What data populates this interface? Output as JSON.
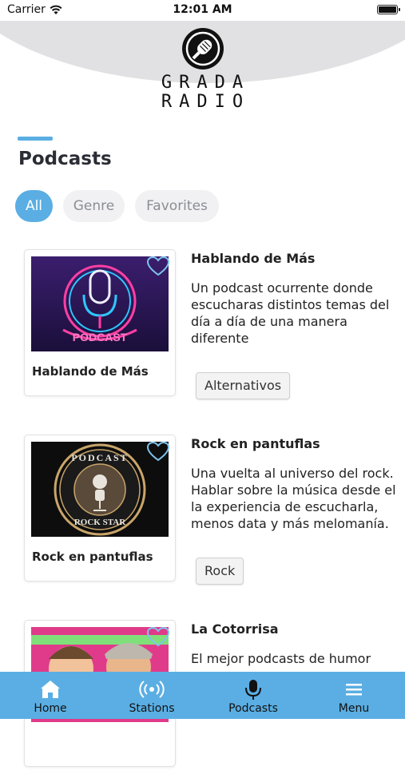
{
  "status_bar": {
    "carrier": "Carrier",
    "time": "12:01 AM"
  },
  "brand": {
    "line1": "GRADA",
    "line2": "RADIO"
  },
  "page": {
    "title": "Podcasts"
  },
  "filters": [
    {
      "label": "All",
      "active": true
    },
    {
      "label": "Genre",
      "active": false
    },
    {
      "label": "Favorites",
      "active": false
    }
  ],
  "podcasts": [
    {
      "card_title": "Hablando de Más",
      "title": "Hablando de Más",
      "description": "Un podcast ocurrente donde escucharas distintos temas del día a día de una manera diferente",
      "genre": "Alternativos",
      "thumb_text": "PODCAST"
    },
    {
      "card_title": "Rock en pantuflas",
      "title": "Rock en pantuflas",
      "description": "Una vuelta al universo del rock. Hablar sobre la música desde el la experiencia de escucharla, menos data y más melomanía.",
      "genre": "Rock",
      "thumb_text_top": "PODCAST",
      "thumb_text_bottom": "ROCK STAR"
    },
    {
      "title": "La Cotorrisa",
      "description": "El mejor podcasts de humor"
    }
  ],
  "nav": [
    {
      "label": "Home",
      "icon": "home-icon"
    },
    {
      "label": "Stations",
      "icon": "broadcast-icon"
    },
    {
      "label": "Podcasts",
      "icon": "microphone-icon"
    },
    {
      "label": "Menu",
      "icon": "menu-icon"
    }
  ],
  "colors": {
    "accent": "#5aaee3",
    "header_arc": "#e1e1e3",
    "tab_inactive": "#f1f1f3"
  }
}
